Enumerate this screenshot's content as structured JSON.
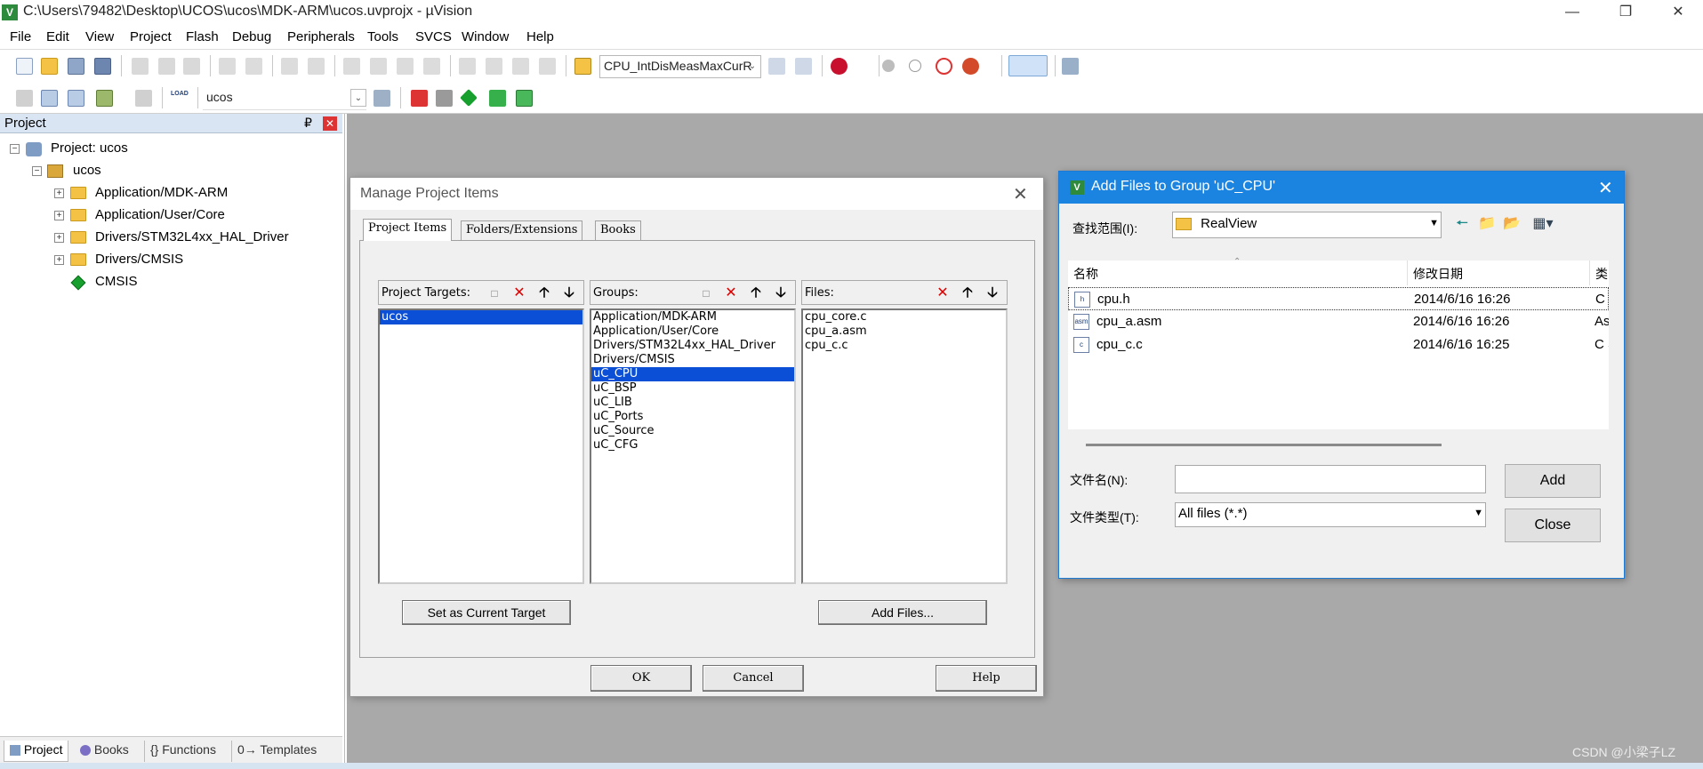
{
  "window": {
    "title": "C:\\Users\\79482\\Desktop\\UCOS\\ucos\\MDK-ARM\\ucos.uvprojx - µVision",
    "icon": "V",
    "minimize": "—",
    "restore": "❐",
    "close": "✕"
  },
  "menu": [
    "File",
    "Edit",
    "View",
    "Project",
    "Flash",
    "Debug",
    "Peripherals",
    "Tools",
    "SVCS",
    "Window",
    "Help"
  ],
  "toolbar": {
    "find_combo": "CPU_IntDisMeasMaxCurR",
    "target_combo": "ucos",
    "load_label": "LOAD"
  },
  "project_panel": {
    "title": "Project",
    "pin": "₽",
    "close": "✕",
    "root": "Project: ucos",
    "target": "ucos",
    "groups": [
      "Application/MDK-ARM",
      "Application/User/Core",
      "Drivers/STM32L4xx_HAL_Driver",
      "Drivers/CMSIS"
    ],
    "cmsis": "CMSIS",
    "tabs": [
      "Project",
      "Books",
      "{} Functions",
      "0→ Templates"
    ]
  },
  "manage_dialog": {
    "title": "Manage Project Items",
    "close": "✕",
    "tabs": [
      "Project Items",
      "Folders/Extensions",
      "Books"
    ],
    "targets_label": "Project Targets:",
    "groups_label": "Groups:",
    "files_label": "Files:",
    "targets": [
      "ucos"
    ],
    "selected_target": "ucos",
    "groups": [
      "Application/MDK-ARM",
      "Application/User/Core",
      "Drivers/STM32L4xx_HAL_Driver",
      "Drivers/CMSIS",
      "uC_CPU",
      "uC_BSP",
      "uC_LIB",
      "uC_Ports",
      "uC_Source",
      "uC_CFG"
    ],
    "selected_group": "uC_CPU",
    "files": [
      "cpu_core.c",
      "cpu_a.asm",
      "cpu_c.c"
    ],
    "set_current_target": "Set as Current Target",
    "add_files": "Add Files...",
    "ok": "OK",
    "cancel": "Cancel",
    "help": "Help"
  },
  "add_files_dialog": {
    "title": "Add Files to Group 'uC_CPU'",
    "close": "✕",
    "look_in_label": "查找范围(I):",
    "look_in_value": "RealView",
    "columns": [
      "名称",
      "修改日期",
      "类"
    ],
    "files": [
      {
        "name": "cpu.h",
        "date": "2014/6/16 16:26",
        "type": "C I",
        "icon": "h"
      },
      {
        "name": "cpu_a.asm",
        "date": "2014/6/16 16:26",
        "type": "As",
        "icon": "asm"
      },
      {
        "name": "cpu_c.c",
        "date": "2014/6/16 16:25",
        "type": "C S",
        "icon": "c"
      }
    ],
    "filename_label": "文件名(N):",
    "filename_value": "",
    "filetype_label": "文件类型(T):",
    "filetype_value": "All files (*.*)",
    "add": "Add",
    "close_btn": "Close"
  },
  "watermark": "CSDN @小梁子LZ",
  "colors": {
    "selection": "#0a4fd6",
    "dialog_title_blue": "#1a84e0",
    "workspace_gray": "#a9a9a9"
  }
}
